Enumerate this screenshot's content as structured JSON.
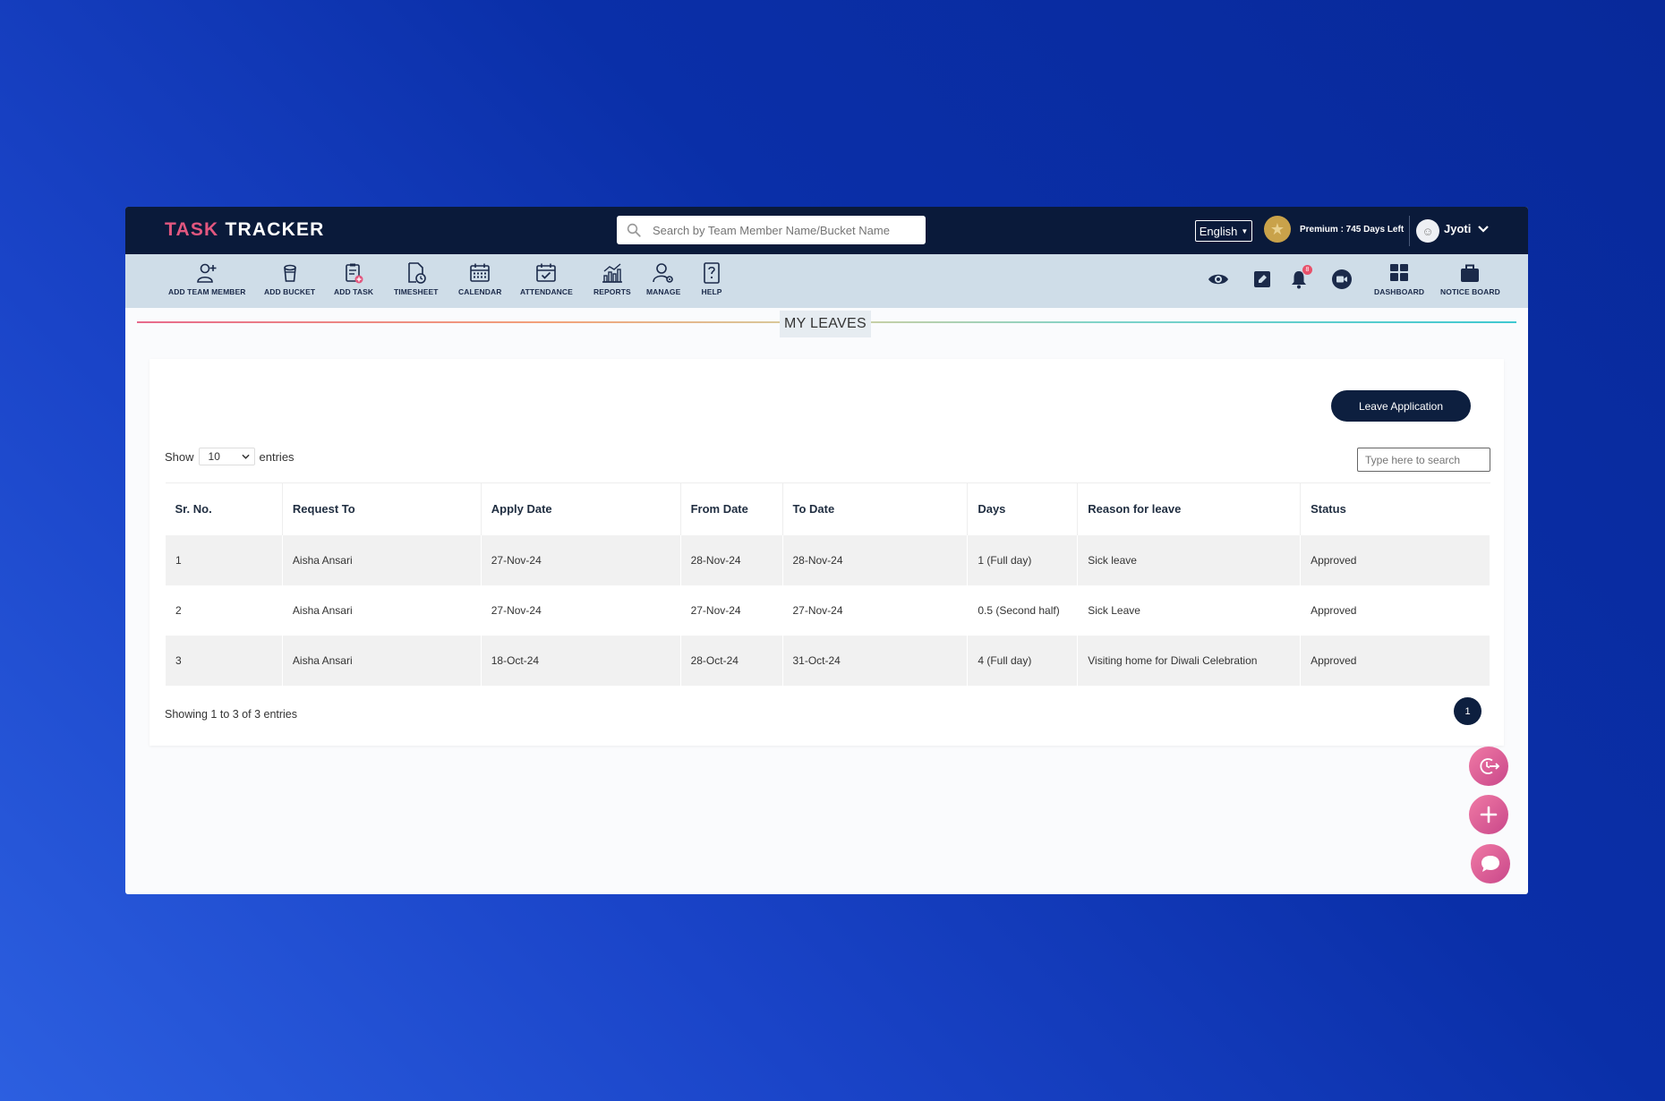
{
  "header": {
    "logo_part1": "TASK",
    "logo_part2": "TRACKER",
    "search_placeholder": "Search by Team Member Name/Bucket Name",
    "language": "English",
    "premium_text": "Premium : 745 Days Left",
    "user_name": "Jyoti"
  },
  "toolbar": {
    "items": [
      {
        "label": "ADD TEAM MEMBER",
        "icon": "add-user-icon"
      },
      {
        "label": "ADD BUCKET",
        "icon": "bucket-icon"
      },
      {
        "label": "ADD TASK",
        "icon": "add-task-icon"
      },
      {
        "label": "TIMESHEET",
        "icon": "timesheet-icon"
      },
      {
        "label": "CALENDAR",
        "icon": "calendar-icon"
      },
      {
        "label": "ATTENDANCE",
        "icon": "attendance-icon"
      },
      {
        "label": "REPORTS",
        "icon": "reports-icon"
      },
      {
        "label": "MANAGE",
        "icon": "manage-icon"
      },
      {
        "label": "HELP",
        "icon": "help-icon"
      }
    ],
    "right_items": [
      {
        "label": "DASHBOARD",
        "icon": "dashboard-icon"
      },
      {
        "label": "NOTICE BOARD",
        "icon": "briefcase-icon"
      }
    ],
    "notification_count": "8"
  },
  "page": {
    "title": "MY LEAVES",
    "leave_button": "Leave Application",
    "show_label": "Show",
    "entries_value": "10",
    "entries_label": "entries",
    "table_search_placeholder": "Type here to search",
    "showing_text": "Showing 1 to 3 of 3 entries",
    "current_page": "1"
  },
  "table": {
    "headers": [
      "Sr. No.",
      "Request To",
      "Apply Date",
      "From Date",
      "To Date",
      "Days",
      "Reason for leave",
      "Status"
    ],
    "rows": [
      [
        "1",
        "Aisha Ansari",
        "27-Nov-24",
        "28-Nov-24",
        "28-Nov-24",
        "1 (Full day)",
        "Sick leave",
        "Approved"
      ],
      [
        "2",
        "Aisha Ansari",
        "27-Nov-24",
        "27-Nov-24",
        "27-Nov-24",
        "0.5 (Second half)",
        "Sick Leave",
        "Approved"
      ],
      [
        "3",
        "Aisha Ansari",
        "18-Oct-24",
        "28-Oct-24",
        "31-Oct-24",
        "4 (Full day)",
        "Visiting home for Diwali Celebration",
        "Approved"
      ]
    ]
  },
  "colors": {
    "header_bg": "#0a1a3a",
    "toolbar_bg": "#cfdde8",
    "accent_pink": "#e2577f",
    "button_navy": "#0d1f3f"
  }
}
